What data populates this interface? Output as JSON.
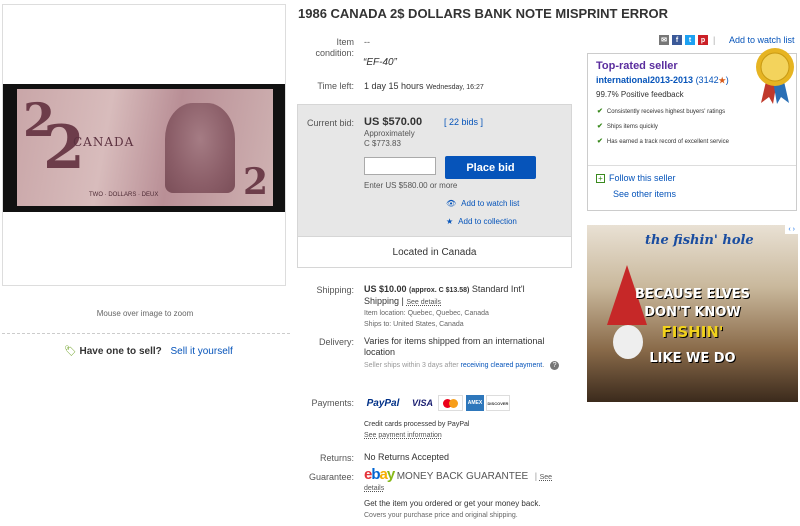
{
  "listing": {
    "title": "1986 CANADA 2$ DOLLARS BANK NOTE MISPRINT ERROR",
    "zoom_hint": "Mouse over image to zoom",
    "sell_prompt": "Have one to sell?",
    "sell_link": "Sell it yourself"
  },
  "banknote": {
    "denomination": "2",
    "country": "CANADA",
    "bottom_text": "TWO · DOLLARS · DEUX"
  },
  "condition": {
    "label": "Item condition:",
    "value": "--",
    "quote": "“EF-40”"
  },
  "time_left": {
    "label": "Time left:",
    "value": "1 day 15 hours",
    "end": "Wednesday, 16:27"
  },
  "bid": {
    "label": "Current bid:",
    "amount": "US $570.00",
    "bids_link": "[ 22 bids ]",
    "approx_label": "Approximately",
    "approx_value": "C $773.83",
    "input_placeholder": "",
    "place_bid": "Place bid",
    "enter_hint": "Enter US $580.00 or more",
    "add_watch": "Add to watch list",
    "add_collection": "Add to collection",
    "located": "Located in Canada"
  },
  "shipping": {
    "label": "Shipping:",
    "price": "US $10.00",
    "approx": "(approx. C $13.58)",
    "service": "Standard Int'l",
    "service2": "Shipping",
    "see_details": "See details",
    "item_location": "Item location:  Quebec, Quebec, Canada",
    "ships_to": "Ships to:  United States, Canada"
  },
  "delivery": {
    "label": "Delivery:",
    "text": "Varies for items shipped from an international location",
    "note": "Seller ships within 3 days after",
    "note_link": "receiving cleared payment",
    "note_end": ".",
    "help": "?"
  },
  "payments": {
    "label": "Payments:",
    "logos": [
      "PayPal",
      "VISA",
      "MC",
      "AMEX",
      "DISCOVER"
    ],
    "credit_note": "Credit cards processed by PayPal",
    "see_info": "See payment information"
  },
  "returns": {
    "label": "Returns:",
    "value": "No Returns Accepted"
  },
  "guarantee": {
    "label": "Guarantee:",
    "brand": "ebay",
    "title": "MONEY BACK GUARANTEE",
    "see": "See",
    "details": "details",
    "line1": "Get the item you ordered or get your money back.",
    "line2": "Covers your purchase price and original shipping."
  },
  "share": {
    "watch_link": "Add to watch list",
    "icons": [
      "mail-icon",
      "facebook-icon",
      "twitter-icon",
      "pinterest-icon"
    ]
  },
  "seller": {
    "badge": "Top-rated seller",
    "name": "international2013-2013",
    "score": "(3142",
    "score_end": ")",
    "feedback": "99.7% Positive feedback",
    "checks": [
      "Consistently receives highest buyers' ratings",
      "Ships items quickly",
      "Has earned a track record of excellent service"
    ],
    "follow": "Follow this seller",
    "other": "See other items"
  },
  "ad": {
    "logo": "the fishin' hole",
    "line1": "BECAUSE ELVES",
    "line2": "DON'T KNOW",
    "line3": "FISHIN'",
    "line4": "LIKE WE DO",
    "nav": "‹ ›"
  },
  "colors": {
    "link": "#0654ba",
    "button": "#0654ba",
    "top_rated": "#5a2d9e",
    "check": "#3a8a1e"
  }
}
